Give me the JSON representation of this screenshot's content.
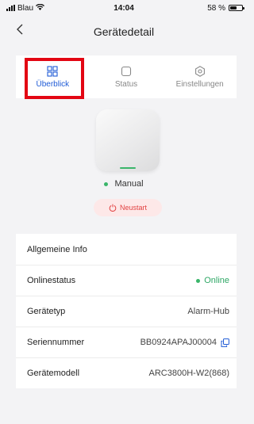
{
  "status_bar": {
    "carrier": "Blau",
    "time": "14:04",
    "battery": "58 %",
    "battery_level": 0.58
  },
  "nav": {
    "title": "Gerätedetail",
    "back_icon": "chevron-left-icon"
  },
  "tabs": [
    {
      "label": "Überblick",
      "icon": "grid-icon",
      "active": true
    },
    {
      "label": "Status",
      "icon": "square-icon",
      "active": false
    },
    {
      "label": "Einstellungen",
      "icon": "hexagon-settings-icon",
      "active": false
    }
  ],
  "device": {
    "mode_label": "Manual",
    "restart_label": "Neustart"
  },
  "info": {
    "section_title": "Allgemeine Info",
    "rows": [
      {
        "label": "Onlinestatus",
        "value": "Online"
      },
      {
        "label": "Gerätetyp",
        "value": "Alarm-Hub"
      },
      {
        "label": "Seriennummer",
        "value": "BB0924APAJ00004"
      },
      {
        "label": "Gerätemodell",
        "value": "ARC3800H-W2(868)"
      }
    ]
  },
  "colors": {
    "accent": "#1f5bd6",
    "online": "#2fa866",
    "restart": "#e24242",
    "highlight": "#e30613"
  }
}
